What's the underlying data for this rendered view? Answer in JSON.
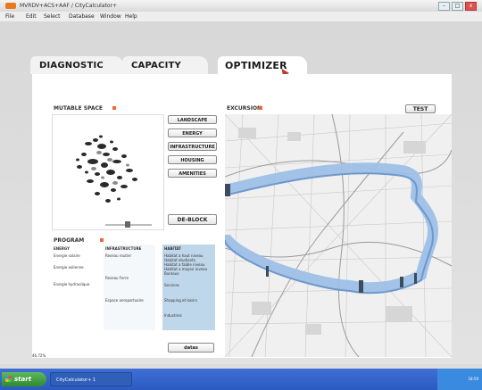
{
  "window": {
    "title": "MVRDV+ACS+AAF / CityCalculator+",
    "close_label": "x"
  },
  "menu": [
    "File",
    "Edit",
    "Select",
    "Database",
    "Window",
    "Help"
  ],
  "tabs": [
    {
      "label": "DIAGNOSTIC",
      "active": false
    },
    {
      "label": "CAPACITY",
      "active": false
    },
    {
      "label": "OPTIMIZER",
      "active": true
    }
  ],
  "sections": {
    "mutable_space": "MUTABLE SPACE",
    "program": "PROGRAM",
    "excursion": "EXCURSION"
  },
  "buttons": {
    "landscape": "LANDSCAPE",
    "energy": "ENERGY",
    "infrastructure": "INFRASTRUCTURE",
    "housing": "HOUSING",
    "amenities": "AMENITIES",
    "deblock": "DE-BLOCK",
    "test": "TEST",
    "datas": "datas"
  },
  "program": {
    "headers": [
      "ENERGY",
      "INFRASTRUCTURE",
      "HABITAT"
    ],
    "energy": [
      "Energie solaire",
      "Energie eolienne",
      "Energie hydraulique"
    ],
    "infrastructure": [
      "Reseau routier",
      "Reseau Ferre",
      "Espace aeroportuaire"
    ],
    "habitat": [
      "Habitat a haut niveau",
      "Habitat etudiants",
      "Habitat a faible niveau",
      "Habitat a moyen niveau",
      "Bureaux",
      "Services",
      "Shopping et loisirs",
      "Industries"
    ]
  },
  "status": {
    "percent": "46.72%"
  },
  "taskbar": {
    "start": "start",
    "task": "CityCalculator+ 1",
    "clock": "18:59"
  },
  "colors": {
    "accent": "#e8693a",
    "ring": "#8fb4e4",
    "highlight": "#bfd7ea"
  }
}
